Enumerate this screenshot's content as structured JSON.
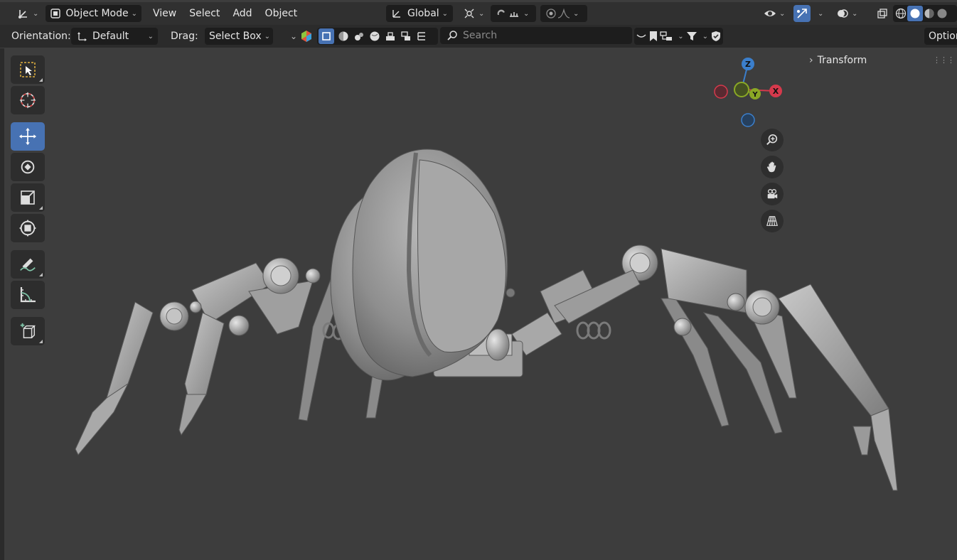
{
  "header": {
    "mode": "Object Mode",
    "menus": [
      "View",
      "Select",
      "Add",
      "Object"
    ],
    "transform_orientation": "Global"
  },
  "tool_settings": {
    "orientation_label": "Orientation:",
    "orientation_value": "Default",
    "drag_label": "Drag:",
    "drag_value": "Select Box",
    "search_placeholder": "Search",
    "options_label": "Option"
  },
  "sidebar": {
    "panel_title": "Transform"
  },
  "gizmo": {
    "axes": [
      "Z",
      "Y",
      "X"
    ],
    "colors": {
      "x": "#d6394c",
      "y": "#8aa825",
      "z": "#3b7fcc"
    }
  },
  "toolbar": {
    "tools": [
      "select-box",
      "cursor",
      "move",
      "rotate",
      "scale",
      "transform",
      "annotate",
      "measure",
      "add-cube"
    ],
    "active_tool": "move"
  },
  "colors": {
    "accent": "#4772b3",
    "background": "#3d3d3d",
    "header": "#303030"
  }
}
